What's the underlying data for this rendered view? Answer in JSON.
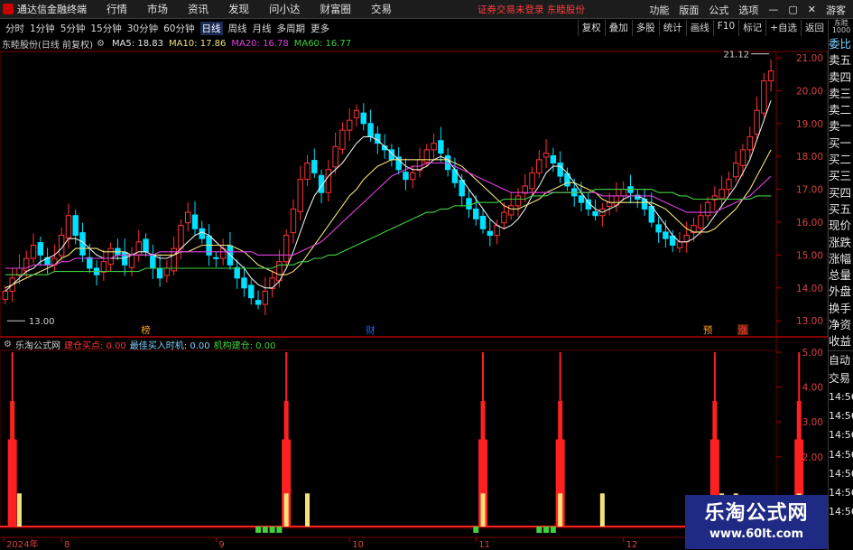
{
  "menubar": {
    "app_title": "通达信金融终端",
    "menus": [
      "行情",
      "市场",
      "资讯",
      "发现",
      "问小达",
      "财富圈",
      "交易"
    ],
    "warning": "证券交易未登录  东睦股份",
    "right": [
      "功能",
      "版面",
      "公式",
      "选项"
    ],
    "guest": "游客"
  },
  "toolbar": {
    "periods": [
      "分时",
      "1分钟",
      "5分钟",
      "15分钟",
      "30分钟",
      "60分钟",
      "日线",
      "周线",
      "月线",
      "多周期",
      "更多"
    ],
    "active_period": "日线",
    "buttons": [
      "复权",
      "叠加",
      "多股",
      "统计",
      "画线",
      "F10",
      "标记",
      "+自选",
      "返回"
    ]
  },
  "info": {
    "stock": "东睦股份(日线 前复权)",
    "ma": [
      {
        "label": "MA5: 18.83",
        "color": "#e8e8e8"
      },
      {
        "label": "MA10: 17.86",
        "color": "#f2e27a"
      },
      {
        "label": "MA20: 16.78",
        "color": "#e040e0"
      },
      {
        "label": "MA60: 16.77",
        "color": "#40d040"
      }
    ]
  },
  "chart_data": [
    {
      "type": "candlestick",
      "title": "东睦股份(日线 前复权)",
      "y_ticks": [
        "21.00",
        "20.00",
        "19.00",
        "18.00",
        "17.00",
        "16.00",
        "15.00",
        "14.00",
        "13.00"
      ],
      "ylim": [
        12.8,
        21.8
      ],
      "max_label": "21.12",
      "min_label": "13.00",
      "colors": {
        "up": "#ff3232",
        "down": "#00e0ff",
        "ma5": "#e8e8e8",
        "ma10": "#f2e27a",
        "ma20": "#e040e0",
        "ma60": "#40d040"
      },
      "events": [
        {
          "label": "榜",
          "index": 20
        },
        {
          "label": "财",
          "index": 52
        },
        {
          "label": "预",
          "index": 100
        },
        {
          "label": "涨",
          "index": 105
        }
      ],
      "closes": [
        13.9,
        14.3,
        14.6,
        14.9,
        15.3,
        15.0,
        14.7,
        14.9,
        15.6,
        16.2,
        15.6,
        15.0,
        14.6,
        14.4,
        14.8,
        15.2,
        15.0,
        14.7,
        15.0,
        15.4,
        15.1,
        14.6,
        14.3,
        14.6,
        15.2,
        15.9,
        16.3,
        15.8,
        15.5,
        15.0,
        14.9,
        15.2,
        14.7,
        14.3,
        14.0,
        13.7,
        13.5,
        13.9,
        14.3,
        14.8,
        15.6,
        16.4,
        17.3,
        17.8,
        17.5,
        16.9,
        17.6,
        18.3,
        18.8,
        19.1,
        19.4,
        19.0,
        18.6,
        18.4,
        18.2,
        17.9,
        17.6,
        17.3,
        17.5,
        17.9,
        18.2,
        18.4,
        18.1,
        17.6,
        17.2,
        16.8,
        16.4,
        16.1,
        15.8,
        15.6,
        15.9,
        16.3,
        16.5,
        16.8,
        17.1,
        17.5,
        17.9,
        18.1,
        17.8,
        17.4,
        17.1,
        16.8,
        16.6,
        16.4,
        16.2,
        16.4,
        16.6,
        16.8,
        17.0,
        16.9,
        16.7,
        16.4,
        16.0,
        15.7,
        15.5,
        15.3,
        15.4,
        15.6,
        15.9,
        16.2,
        16.6,
        16.8,
        17.0,
        17.3,
        17.8,
        18.2,
        18.6,
        19.4,
        20.3,
        20.6
      ],
      "ma5": [
        13.9,
        14.1,
        14.3,
        14.5,
        14.6,
        14.8,
        14.9,
        15.0,
        15.2,
        15.5,
        15.5,
        15.4,
        15.2,
        15.0,
        14.9,
        14.9,
        14.9,
        14.9,
        15.0,
        15.1,
        15.1,
        15.0,
        14.9,
        14.9,
        15.0,
        15.2,
        15.4,
        15.6,
        15.7,
        15.6,
        15.4,
        15.2,
        15.0,
        14.8,
        14.6,
        14.3,
        14.1,
        14.0,
        14.0,
        14.2,
        14.6,
        15.1,
        15.7,
        16.3,
        16.8,
        17.1,
        17.4,
        17.6,
        17.8,
        18.1,
        18.4,
        18.6,
        18.6,
        18.5,
        18.3,
        18.1,
        17.9,
        17.7,
        17.6,
        17.6,
        17.7,
        17.9,
        18.0,
        17.9,
        17.6,
        17.3,
        17.0,
        16.7,
        16.4,
        16.1,
        15.9,
        15.8,
        15.9,
        16.1,
        16.4,
        16.8,
        17.1,
        17.5,
        17.7,
        17.7,
        17.5,
        17.2,
        16.9,
        16.6,
        16.4,
        16.3,
        16.4,
        16.5,
        16.7,
        16.8,
        16.8,
        16.7,
        16.5,
        16.2,
        15.9,
        15.6,
        15.4,
        15.4,
        15.5,
        15.7,
        15.9,
        16.2,
        16.5,
        16.8,
        17.1,
        17.5,
        17.9,
        18.5,
        19.1,
        19.7
      ],
      "ma10": [
        14.0,
        14.1,
        14.2,
        14.3,
        14.4,
        14.5,
        14.6,
        14.7,
        14.9,
        15.0,
        15.2,
        15.2,
        15.2,
        15.2,
        15.1,
        15.1,
        15.1,
        15.1,
        15.0,
        15.0,
        15.0,
        15.0,
        15.0,
        15.0,
        15.0,
        15.1,
        15.1,
        15.2,
        15.3,
        15.3,
        15.3,
        15.3,
        15.3,
        15.2,
        15.1,
        14.9,
        14.7,
        14.6,
        14.5,
        14.4,
        14.4,
        14.5,
        14.7,
        15.0,
        15.3,
        15.6,
        15.9,
        16.2,
        16.5,
        16.8,
        17.0,
        17.3,
        17.5,
        17.7,
        17.8,
        17.9,
        17.9,
        17.9,
        17.9,
        17.9,
        17.9,
        17.9,
        17.9,
        17.9,
        17.8,
        17.7,
        17.5,
        17.3,
        17.1,
        16.9,
        16.7,
        16.5,
        16.4,
        16.4,
        16.5,
        16.6,
        16.7,
        16.9,
        17.0,
        17.1,
        17.2,
        17.2,
        17.1,
        17.0,
        16.9,
        16.7,
        16.6,
        16.6,
        16.6,
        16.6,
        16.6,
        16.6,
        16.6,
        16.5,
        16.4,
        16.2,
        16.0,
        15.8,
        15.7,
        15.7,
        15.7,
        15.8,
        16.0,
        16.2,
        16.4,
        16.7,
        17.0,
        17.4,
        17.8,
        18.2
      ],
      "ma20": [
        14.6,
        14.6,
        14.6,
        14.6,
        14.7,
        14.7,
        14.7,
        14.7,
        14.8,
        14.8,
        14.9,
        14.9,
        14.9,
        14.9,
        14.9,
        14.9,
        15.0,
        15.0,
        15.0,
        15.0,
        15.0,
        15.0,
        15.1,
        15.1,
        15.1,
        15.1,
        15.1,
        15.1,
        15.1,
        15.1,
        15.1,
        15.1,
        15.1,
        15.1,
        15.1,
        15.1,
        15.0,
        15.0,
        15.0,
        15.0,
        15.0,
        15.0,
        15.1,
        15.2,
        15.3,
        15.4,
        15.6,
        15.8,
        16.0,
        16.2,
        16.4,
        16.6,
        16.8,
        17.0,
        17.2,
        17.4,
        17.5,
        17.6,
        17.7,
        17.7,
        17.8,
        17.8,
        17.8,
        17.8,
        17.7,
        17.6,
        17.5,
        17.4,
        17.3,
        17.2,
        17.1,
        17.0,
        16.9,
        16.9,
        16.9,
        16.9,
        16.9,
        16.9,
        16.9,
        16.9,
        16.9,
        16.9,
        16.9,
        16.9,
        16.9,
        16.8,
        16.8,
        16.8,
        16.8,
        16.8,
        16.8,
        16.8,
        16.8,
        16.7,
        16.6,
        16.5,
        16.4,
        16.3,
        16.3,
        16.3,
        16.3,
        16.3,
        16.4,
        16.5,
        16.6,
        16.7,
        16.8,
        17.0,
        17.2,
        17.4
      ],
      "ma60": [
        14.4,
        14.4,
        14.4,
        14.4,
        14.4,
        14.4,
        14.4,
        14.5,
        14.5,
        14.5,
        14.5,
        14.5,
        14.5,
        14.5,
        14.5,
        14.5,
        14.5,
        14.5,
        14.5,
        14.5,
        14.6,
        14.6,
        14.6,
        14.6,
        14.6,
        14.6,
        14.6,
        14.6,
        14.6,
        14.6,
        14.6,
        14.6,
        14.6,
        14.6,
        14.6,
        14.6,
        14.6,
        14.6,
        14.6,
        14.7,
        14.7,
        14.7,
        14.8,
        14.8,
        14.9,
        14.9,
        15.0,
        15.0,
        15.1,
        15.2,
        15.3,
        15.4,
        15.5,
        15.6,
        15.7,
        15.8,
        15.9,
        16.0,
        16.1,
        16.2,
        16.3,
        16.3,
        16.4,
        16.4,
        16.5,
        16.5,
        16.5,
        16.6,
        16.6,
        16.6,
        16.6,
        16.7,
        16.7,
        16.7,
        16.7,
        16.8,
        16.8,
        16.8,
        16.9,
        16.9,
        16.9,
        16.9,
        16.9,
        16.9,
        17.0,
        17.0,
        17.0,
        17.0,
        17.0,
        17.0,
        17.0,
        17.0,
        17.0,
        16.9,
        16.9,
        16.9,
        16.8,
        16.8,
        16.7,
        16.7,
        16.7,
        16.7,
        16.7,
        16.7,
        16.7,
        16.7,
        16.7,
        16.8,
        16.8,
        16.8
      ]
    },
    {
      "type": "bar",
      "title": "乐淘公式网",
      "series": [
        {
          "name": "建仓买点: 0.00",
          "color": "#ff2020",
          "peaks": [
            1,
            40,
            68,
            79,
            101,
            113
          ]
        },
        {
          "name": "最佳买入时机: 0.00",
          "color": "#f2e27a",
          "peaks": [
            2,
            40,
            43,
            68,
            79,
            85,
            102,
            104,
            113
          ]
        },
        {
          "name": "机构建仓: 0.00",
          "color": "#40d040",
          "peaks": [
            36,
            37,
            38,
            39,
            67,
            76,
            77,
            78,
            99,
            100,
            110,
            111,
            112
          ]
        }
      ],
      "y_ticks": [
        "5.00",
        "4.00",
        "3.00",
        "2.00"
      ],
      "ylim": [
        0,
        5.3
      ],
      "x_ticks": [
        {
          "label": "2024年",
          "index": 4
        },
        {
          "label": "8",
          "index": 8
        },
        {
          "label": "9",
          "index": 30
        },
        {
          "label": "10",
          "index": 49
        },
        {
          "label": "11",
          "index": 67
        },
        {
          "label": "12",
          "index": 88
        },
        {
          "label": "1",
          "index": 109
        }
      ]
    }
  ],
  "sidebar": {
    "caption": "东睦 1000",
    "items": [
      "委比",
      "卖五",
      "卖四",
      "卖三",
      "卖二",
      "卖一",
      "买一",
      "买二",
      "买三",
      "买四",
      "买五",
      "现价",
      "涨跌",
      "涨幅",
      "总量",
      "外盘",
      "换手",
      "净资",
      "收益"
    ],
    "lower": [
      "自动",
      "交易"
    ],
    "clock": [
      "14:56",
      "14:56",
      "14:56",
      "14:56",
      "14:56",
      "14:56",
      "14:56"
    ]
  },
  "watermark": {
    "title": "乐淘公式网",
    "url": "www.60lt.com"
  }
}
